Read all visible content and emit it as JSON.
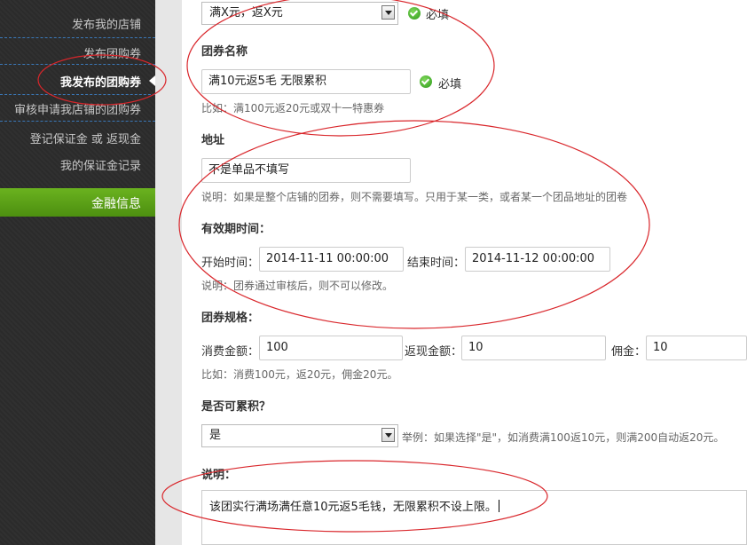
{
  "sidebar": {
    "items": [
      {
        "label": "发布我的店铺"
      },
      {
        "label": "发布团购券"
      },
      {
        "label": "我发布的团购券"
      },
      {
        "label": "审核申请我店铺的团购券"
      },
      {
        "label": "登记保证金 或 返现金"
      },
      {
        "label": "我的保证金记录"
      }
    ],
    "section": "金融信息"
  },
  "form": {
    "type_select": {
      "value": "满X元，返X元"
    },
    "required_text": "必填",
    "name": {
      "label": "团券名称",
      "value": "满10元返5毛 无限累积",
      "hint": "比如：满100元返20元或双十一特惠券"
    },
    "address": {
      "label": "地址",
      "value": "不是单品不填写",
      "hint": "说明：如果是整个店铺的团券，则不需要填写。只用于某一类，或者某一个团品地址的团卷"
    },
    "validity": {
      "label": "有效期时间：",
      "start_label": "开始时间：",
      "start_value": "2014-11-11 00:00:00",
      "end_label": "结束时间：",
      "end_value": "2014-11-12 00:00:00",
      "hint": "说明：团券通过审核后，则不可以修改。"
    },
    "spec": {
      "label": "团券规格：",
      "spend_label": "消费金额：",
      "spend_value": "100",
      "cashback_label": "返现金额：",
      "cashback_value": "10",
      "commission_label": "佣金：",
      "commission_value": "10",
      "hint": "比如：消费100元，返20元，佣金20元。"
    },
    "cumulative": {
      "label": "是否可累积？",
      "value": "是",
      "hint": "举例：如果选择\"是\"，如消费满100返10元，则满200自动返20元。"
    },
    "description": {
      "label": "说明：",
      "value": "该团实行满场满任意10元返5毛钱，无限累积不设上限。"
    }
  },
  "colors": {
    "annotation": "#d9262b",
    "sidebar_bg": "#2b2b2b",
    "active_green": "#5ba317"
  }
}
